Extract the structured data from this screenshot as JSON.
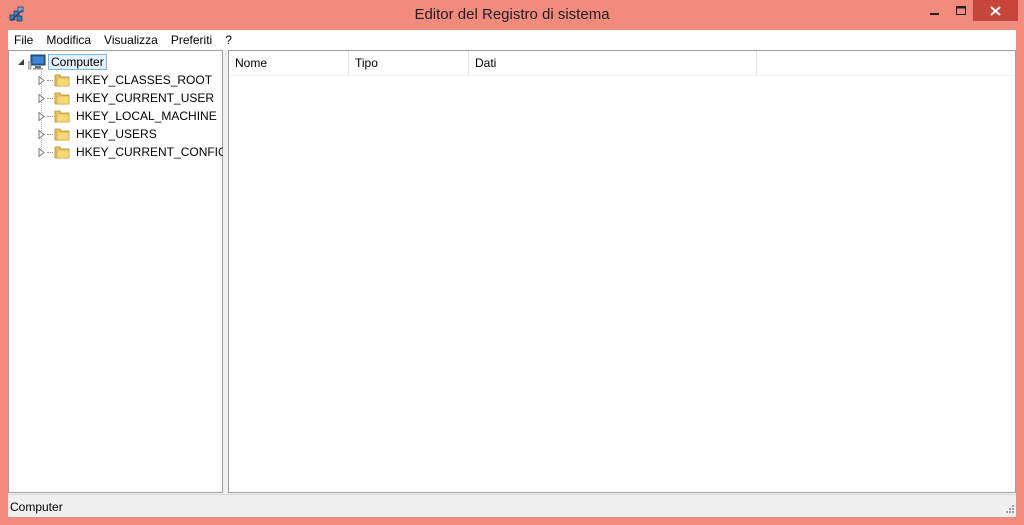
{
  "window": {
    "title": "Editor del Registro di sistema",
    "accent_color": "#f28b7d",
    "close_color": "#c7463b",
    "icons": {
      "app": "registry-editor-icon",
      "minimize": "minimize-icon",
      "maximize": "maximize-icon",
      "close": "close-icon"
    }
  },
  "menu": {
    "items": [
      "File",
      "Modifica",
      "Visualizza",
      "Preferiti",
      "?"
    ]
  },
  "tree": {
    "root": {
      "label": "Computer",
      "icon": "computer-icon",
      "expanded": true
    },
    "children": [
      {
        "label": "HKEY_CLASSES_ROOT",
        "icon": "folder-icon"
      },
      {
        "label": "HKEY_CURRENT_USER",
        "icon": "folder-icon"
      },
      {
        "label": "HKEY_LOCAL_MACHINE",
        "icon": "folder-icon"
      },
      {
        "label": "HKEY_USERS",
        "icon": "folder-icon"
      },
      {
        "label": "HKEY_CURRENT_CONFIG",
        "icon": "folder-icon"
      }
    ]
  },
  "list": {
    "columns": [
      "Nome",
      "Tipo",
      "Dati"
    ]
  },
  "status": {
    "text": "Computer"
  }
}
